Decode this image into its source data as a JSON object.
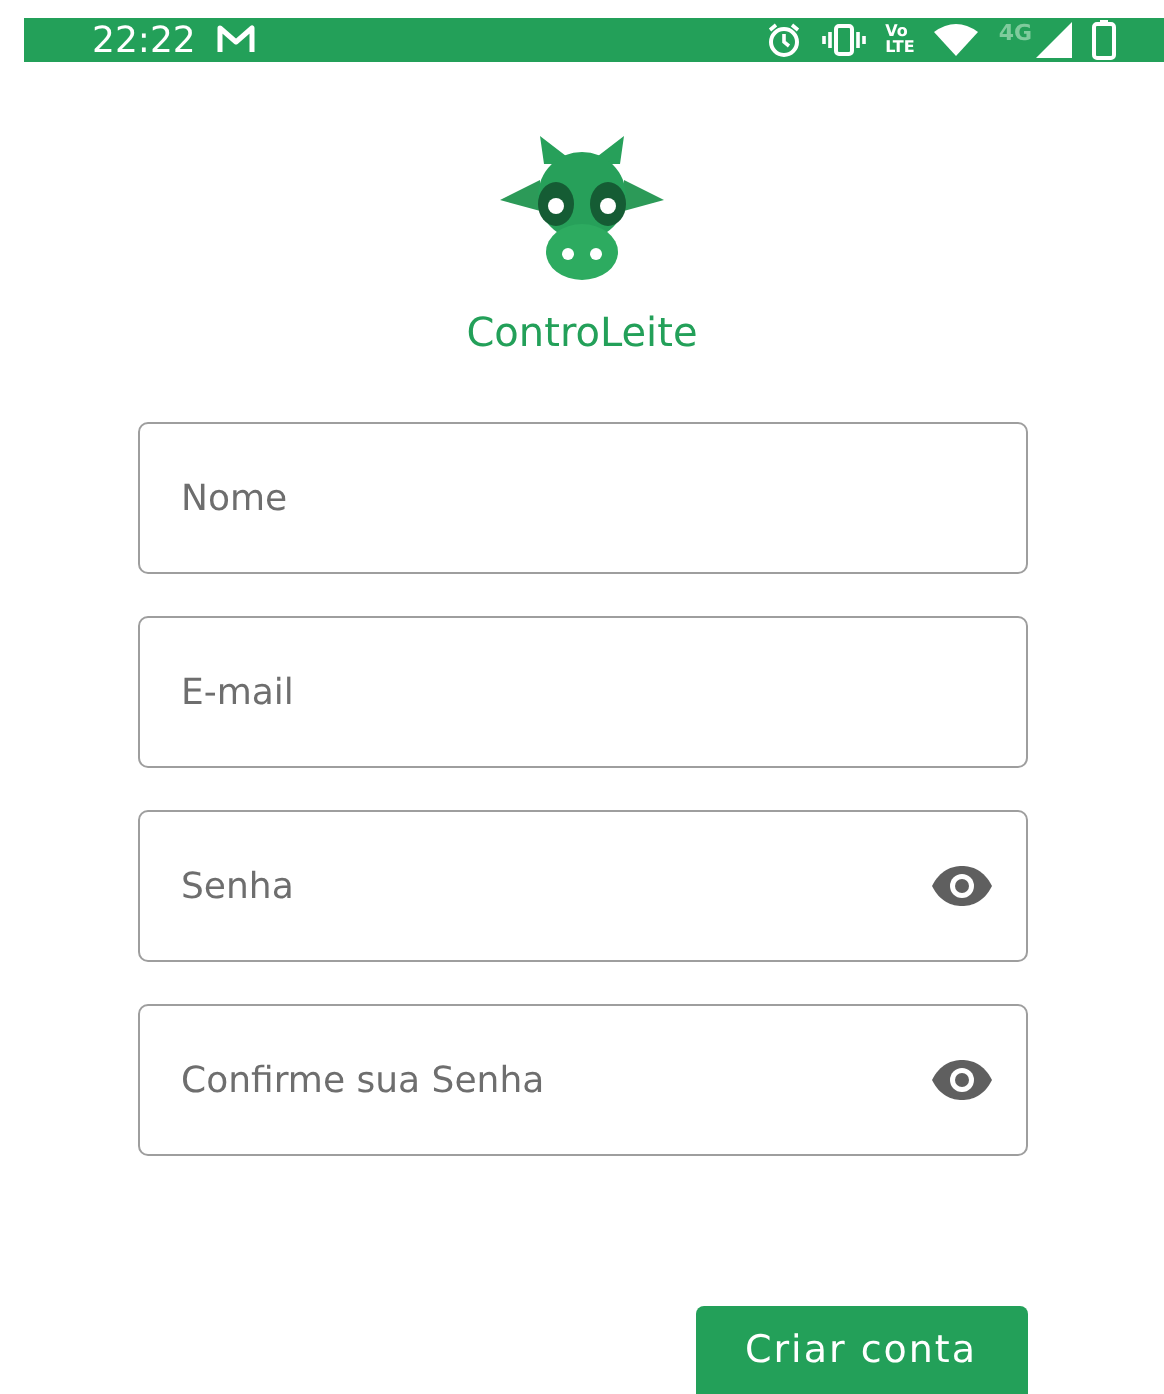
{
  "status_bar": {
    "time": "22:22",
    "volte_top": "Vo",
    "volte_bottom": "LTE",
    "network": "4G"
  },
  "logo": {
    "title": "ControLeite"
  },
  "fields": [
    {
      "placeholder": "Nome",
      "kind": "text"
    },
    {
      "placeholder": "E-mail",
      "kind": "text"
    },
    {
      "placeholder": "Senha",
      "kind": "password"
    },
    {
      "placeholder": "Confirme sua Senha",
      "kind": "password"
    }
  ],
  "submit": {
    "label": "Criar conta"
  }
}
